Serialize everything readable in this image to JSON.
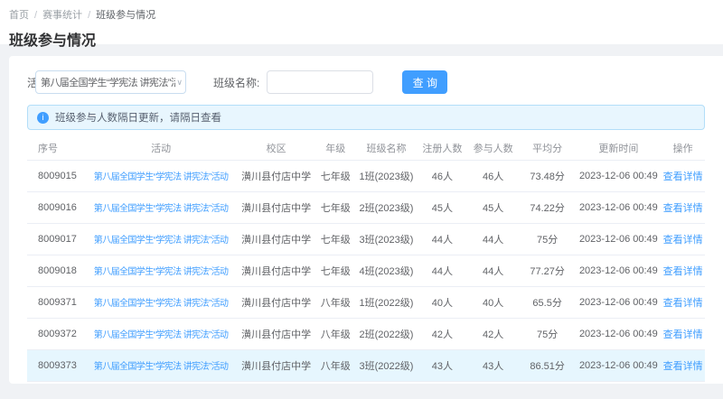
{
  "breadcrumb": {
    "separator": "/",
    "items": [
      "首页",
      "赛事统计",
      "班级参与情况"
    ]
  },
  "page": {
    "title": "班级参与情况"
  },
  "filters": {
    "activity_label": "活动:",
    "activity_selected": "第八届全国学生“学宪法 讲宪法”活动",
    "class_name_label": "班级名称:",
    "class_name_value": "",
    "search_button": "查 询"
  },
  "alert": {
    "icon": "info-circle-icon",
    "text": "班级参与人数隔日更新，请隔日查看"
  },
  "table": {
    "columns": [
      "序号",
      "活动",
      "校区",
      "年级",
      "班级名称",
      "注册人数",
      "参与人数",
      "平均分",
      "更新时间",
      "操作"
    ],
    "rows": [
      {
        "id": "8009015",
        "activity": "第八届全国学生“学宪法 讲宪法”活动",
        "campus": "潢川县付店中学",
        "grade": "七年级",
        "class_name": "1班(2023级)",
        "registered": "46人",
        "participants": "46人",
        "avg_score": "73.48分",
        "updated_at": "2023-12-06 00:49",
        "action": "查看详情",
        "highlight": false
      },
      {
        "id": "8009016",
        "activity": "第八届全国学生“学宪法 讲宪法”活动",
        "campus": "潢川县付店中学",
        "grade": "七年级",
        "class_name": "2班(2023级)",
        "registered": "45人",
        "participants": "45人",
        "avg_score": "74.22分",
        "updated_at": "2023-12-06 00:49",
        "action": "查看详情",
        "highlight": false
      },
      {
        "id": "8009017",
        "activity": "第八届全国学生“学宪法 讲宪法”活动",
        "campus": "潢川县付店中学",
        "grade": "七年级",
        "class_name": "3班(2023级)",
        "registered": "44人",
        "participants": "44人",
        "avg_score": "75分",
        "updated_at": "2023-12-06 00:49",
        "action": "查看详情",
        "highlight": false
      },
      {
        "id": "8009018",
        "activity": "第八届全国学生“学宪法 讲宪法”活动",
        "campus": "潢川县付店中学",
        "grade": "七年级",
        "class_name": "4班(2023级)",
        "registered": "44人",
        "participants": "44人",
        "avg_score": "77.27分",
        "updated_at": "2023-12-06 00:49",
        "action": "查看详情",
        "highlight": false
      },
      {
        "id": "8009371",
        "activity": "第八届全国学生“学宪法 讲宪法”活动",
        "campus": "潢川县付店中学",
        "grade": "八年级",
        "class_name": "1班(2022级)",
        "registered": "40人",
        "participants": "40人",
        "avg_score": "65.5分",
        "updated_at": "2023-12-06 00:49",
        "action": "查看详情",
        "highlight": false
      },
      {
        "id": "8009372",
        "activity": "第八届全国学生“学宪法 讲宪法”活动",
        "campus": "潢川县付店中学",
        "grade": "八年级",
        "class_name": "2班(2022级)",
        "registered": "42人",
        "participants": "42人",
        "avg_score": "75分",
        "updated_at": "2023-12-06 00:49",
        "action": "查看详情",
        "highlight": false
      },
      {
        "id": "8009373",
        "activity": "第八届全国学生“学宪法 讲宪法”活动",
        "campus": "潢川县付店中学",
        "grade": "八年级",
        "class_name": "3班(2022级)",
        "registered": "43人",
        "participants": "43人",
        "avg_score": "86.51分",
        "updated_at": "2023-12-06 00:49",
        "action": "查看详情",
        "highlight": true
      }
    ]
  },
  "colors": {
    "primary": "#409eff",
    "link": "#409eff",
    "alert_bg": "#e8f6fe",
    "alert_border": "#b3def8",
    "row_highlight": "#e6f6fe",
    "page_bg": "#f0f2f5"
  }
}
